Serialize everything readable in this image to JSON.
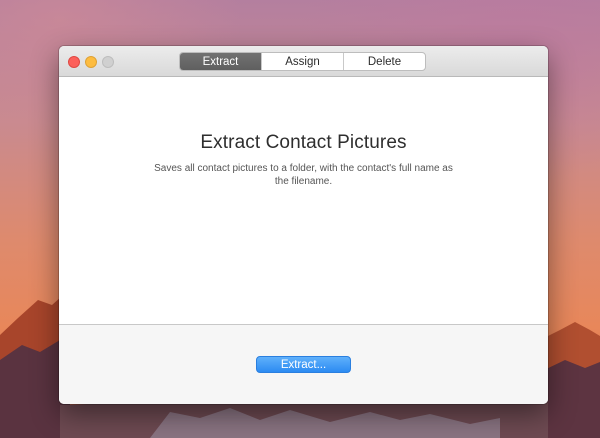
{
  "window": {
    "tabs": [
      {
        "label": "Extract",
        "selected": true
      },
      {
        "label": "Assign",
        "selected": false
      },
      {
        "label": "Delete",
        "selected": false
      }
    ]
  },
  "content": {
    "title": "Extract Contact Pictures",
    "description": "Saves all contact pictures to a folder, with the contact's full name as the filename."
  },
  "footer": {
    "action_label": "Extract..."
  },
  "colors": {
    "accent": "#2c8bf2",
    "selected_tab": "#666666",
    "close": "#fc605b",
    "minimize": "#fdbc40",
    "zoom_inactive": "#d0d0d0"
  },
  "icons": [
    "close-window-icon",
    "minimize-window-icon",
    "zoom-window-icon"
  ]
}
